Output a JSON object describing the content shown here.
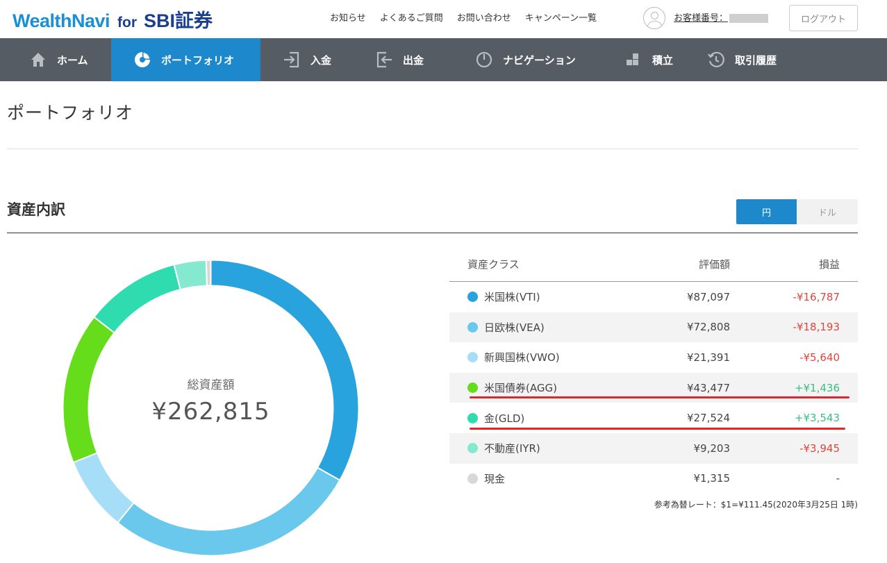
{
  "header": {
    "logo_main": "WealthNavi",
    "logo_for": "for",
    "logo_sbi": "SBI証券",
    "links": [
      "お知らせ",
      "よくあるご質問",
      "お問い合わせ",
      "キャンペーン一覧"
    ],
    "customer_label": "お客様番号：",
    "logout_label": "ログアウト"
  },
  "nav": {
    "items": [
      {
        "label": "ホーム",
        "icon": "home-icon"
      },
      {
        "label": "ポートフォリオ",
        "icon": "pie-chart-icon",
        "active": true
      },
      {
        "label": "入金",
        "icon": "deposit-icon"
      },
      {
        "label": "出金",
        "icon": "withdraw-icon"
      },
      {
        "label": "ナビゲーション",
        "icon": "gauge-icon"
      },
      {
        "label": "積立",
        "icon": "blocks-icon"
      },
      {
        "label": "取引履歴",
        "icon": "history-icon"
      }
    ],
    "active_color": "#1d89cc",
    "bg_color": "#555c63"
  },
  "page": {
    "title": "ポートフォリオ",
    "section_title": "資産内訳",
    "currency_toggle": {
      "yen": "円",
      "dollar": "ドル",
      "selected": "円"
    }
  },
  "summary": {
    "total_label": "総資産額",
    "total_value": "¥262,815"
  },
  "table": {
    "headers": {
      "asset_class": "資産クラス",
      "valuation": "評価額",
      "profit_loss": "損益"
    },
    "rows": [
      {
        "name": "米国株(VTI)",
        "value": "¥87,097",
        "pl": "-¥16,787",
        "color": "#28a3de",
        "sign": "neg"
      },
      {
        "name": "日欧株(VEA)",
        "value": "¥72,808",
        "pl": "-¥18,193",
        "color": "#6ac8ec",
        "sign": "neg"
      },
      {
        "name": "新興国株(VWO)",
        "value": "¥21,391",
        "pl": "-¥5,640",
        "color": "#a6def7",
        "sign": "neg"
      },
      {
        "name": "米国債券(AGG)",
        "value": "¥43,477",
        "pl": "+¥1,436",
        "color": "#66dd1b",
        "sign": "pos"
      },
      {
        "name": "金(GLD)",
        "value": "¥27,524",
        "pl": "+¥3,543",
        "color": "#2edcb0",
        "sign": "pos"
      },
      {
        "name": "不動産(IYR)",
        "value": "¥9,203",
        "pl": "-¥3,945",
        "color": "#85e9cf",
        "sign": "neg"
      },
      {
        "name": "現金",
        "value": "¥1,315",
        "pl": "-",
        "color": "#d8d8d8",
        "sign": "neutral"
      }
    ],
    "rate_note": "参考為替レート：$1=¥111.45(2020年3月25日 1時)"
  },
  "chart_data": {
    "type": "pie",
    "categories": [
      "米国株(VTI)",
      "日欧株(VEA)",
      "新興国株(VWO)",
      "米国債券(AGG)",
      "金(GLD)",
      "不動産(IYR)",
      "現金"
    ],
    "values": [
      87097,
      72808,
      21391,
      43477,
      27524,
      9203,
      1315
    ],
    "colors": [
      "#28a3de",
      "#6ac8ec",
      "#a6def7",
      "#66dd1b",
      "#2edcb0",
      "#85e9cf",
      "#d8d8d8"
    ],
    "donut": true
  },
  "annotations": {
    "highlight_color": "#e3242b"
  }
}
